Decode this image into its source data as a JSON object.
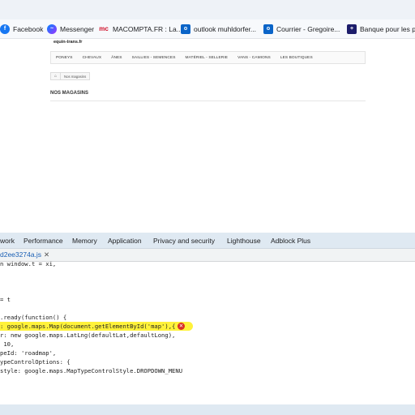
{
  "bookmarks": [
    {
      "label": "Facebook",
      "icon": "facebook-icon",
      "glyph": "f"
    },
    {
      "label": "Messenger",
      "icon": "messenger-icon",
      "glyph": "~"
    },
    {
      "label": "MACOMPTA.FR : La...",
      "icon": "macompta-icon",
      "glyph": "mc"
    },
    {
      "label": "outlook muhldorfer...",
      "icon": "outlook-icon",
      "glyph": "o"
    },
    {
      "label": "Courrier - Gregoire...",
      "icon": "outlook-mail-icon",
      "glyph": "o"
    },
    {
      "label": "Banque pour les pr...",
      "icon": "bank-icon",
      "glyph": "+"
    }
  ],
  "page": {
    "logo_text": "equin-trans.fr",
    "nav": [
      "PONEYS",
      "CHEVAUX",
      "ÂNES",
      "SAILLIES - SEMENCES",
      "MATÉRIEL - SELLERIE",
      "VANS - CAMIONS",
      "LES BOUTIQUES"
    ],
    "breadcrumb_home": "⌂",
    "breadcrumb": "Nos magasins",
    "section_title": "NOS MAGASINS"
  },
  "devtools": {
    "tabs": [
      "work",
      "Performance",
      "Memory",
      "Application",
      "Privacy and security",
      "Lighthouse",
      "Adblock Plus"
    ],
    "file_tab": "d2ee3274a.js",
    "file_close": "✕",
    "error_glyph": "✕",
    "code_lines": [
      "n window.t = xi,",
      "",
      "",
      "",
      "= t",
      "",
      ".ready(function() {",
      ": google.maps.Map(document.getElementById('map'),{",
      "r: new google.maps.LatLng(defaultLat,defaultLong),",
      " 10,",
      "peId: 'roadmap',",
      "ypeControlOptions: {",
      "style: google.maps.MapTypeControlStyle.DROPDOWN_MENU"
    ]
  },
  "colors": {
    "highlight": "#fff23a",
    "error": "#d93025",
    "tabs_bg": "#dfe9f2"
  }
}
